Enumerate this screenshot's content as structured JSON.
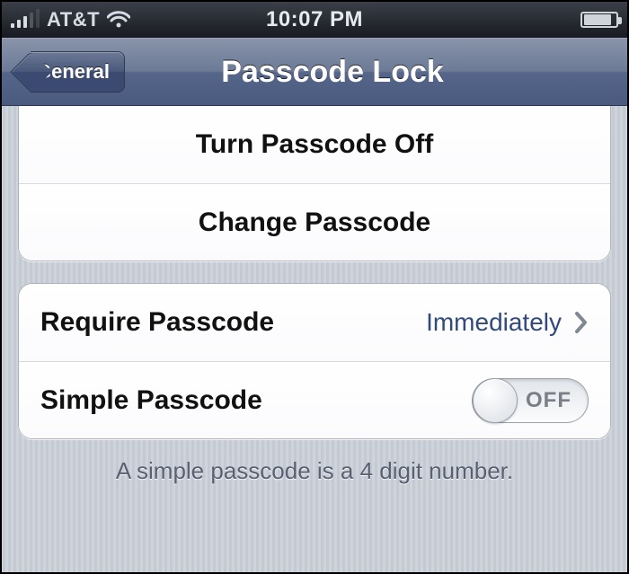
{
  "status_bar": {
    "carrier": "AT&T",
    "time": "10:07 PM"
  },
  "nav": {
    "back_label": "General",
    "title": "Passcode Lock"
  },
  "groups": [
    {
      "rows": [
        {
          "label": "Turn Passcode Off"
        },
        {
          "label": "Change Passcode"
        }
      ]
    },
    {
      "rows": [
        {
          "label": "Require Passcode",
          "value": "Immediately"
        },
        {
          "label": "Simple Passcode",
          "toggle_state": "OFF"
        }
      ]
    }
  ],
  "footer": "A simple passcode is a 4 digit number."
}
